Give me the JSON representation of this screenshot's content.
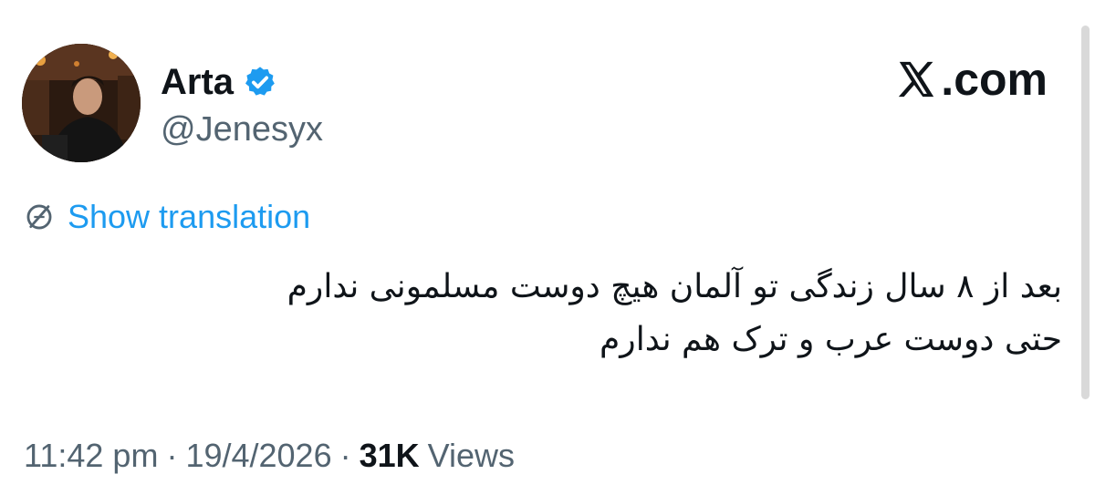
{
  "author": {
    "display_name": "Arta",
    "handle": "@Jenesyx",
    "verified": true,
    "avatar": "avatar-photo"
  },
  "brand": {
    "logo_icon": "x-logo-icon",
    "text": ".com"
  },
  "translate": {
    "icon": "globe-icon",
    "label": "Show translation"
  },
  "tweet": {
    "lines": [
      "بعد از ۸ سال زندگی تو آلمان هیچ دوست مسلمونی ندارم",
      "حتی دوست عرب و ترک هم ندارم"
    ]
  },
  "meta": {
    "time": "11:42 pm",
    "separator": "·",
    "date": "19/4/2026",
    "views_count": "31K",
    "views_label": "Views"
  },
  "colors": {
    "accent": "#1d9bf0",
    "text_primary": "#0f1419",
    "text_secondary": "#536471"
  }
}
